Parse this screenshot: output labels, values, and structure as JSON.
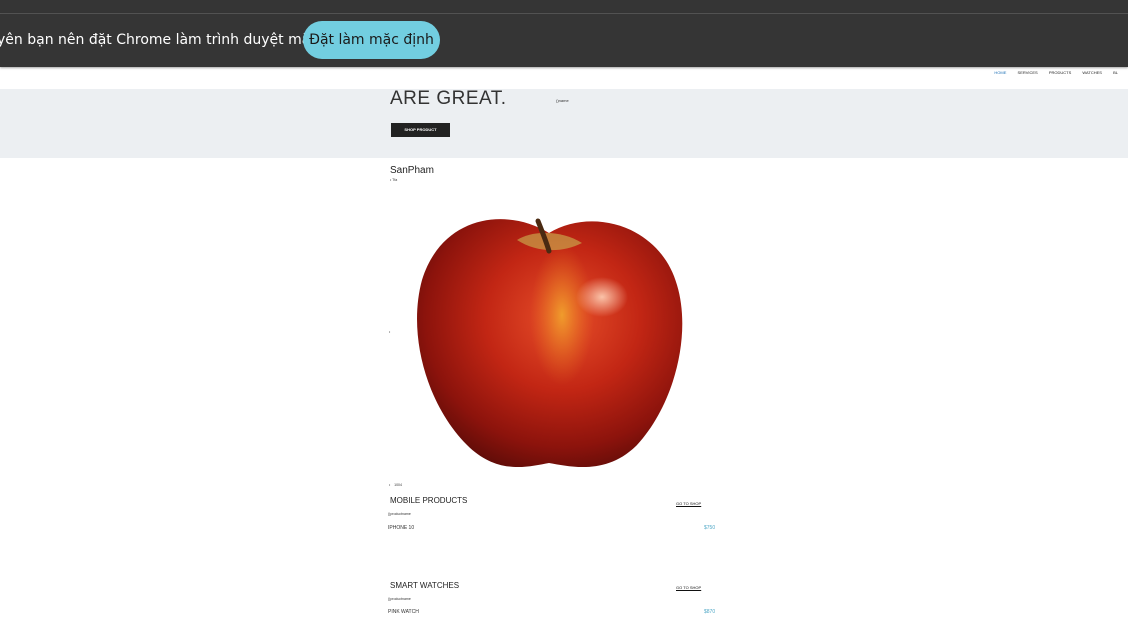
{
  "infobar": {
    "message": "yên bạn nên đặt Chrome làm trình duyệt mặc định",
    "button_label": "Đặt làm mặc định"
  },
  "nav": {
    "items": [
      "HOME",
      "SERVICES",
      "PRODUCTS",
      "WATCHES",
      "BL"
    ],
    "active": "HOME"
  },
  "hero": {
    "title": "ARE GREAT.",
    "image_alt": "()name",
    "button_label": "SHOP PRODUCT"
  },
  "section": {
    "title": "SanPham",
    "bullet_text": "Tfa",
    "bullet_bottom": "1004"
  },
  "categories": [
    {
      "title": "MOBILE PRODUCTS",
      "link": "GO TO SHOP",
      "image_alt": "()productname",
      "item_name": "IPHONE 10",
      "item_price": "$750"
    },
    {
      "title": "SMART WATCHES",
      "link": "GO TO SHOP",
      "image_alt": "()productname",
      "item_name": "PINK WATCH",
      "item_price": "$870"
    }
  ],
  "colors": {
    "bar_bg": "#353535",
    "button_bg": "#72cee0",
    "hero_bg": "#eceff2",
    "price": "#4ea7c6",
    "nav_active": "#1c6fb5"
  }
}
